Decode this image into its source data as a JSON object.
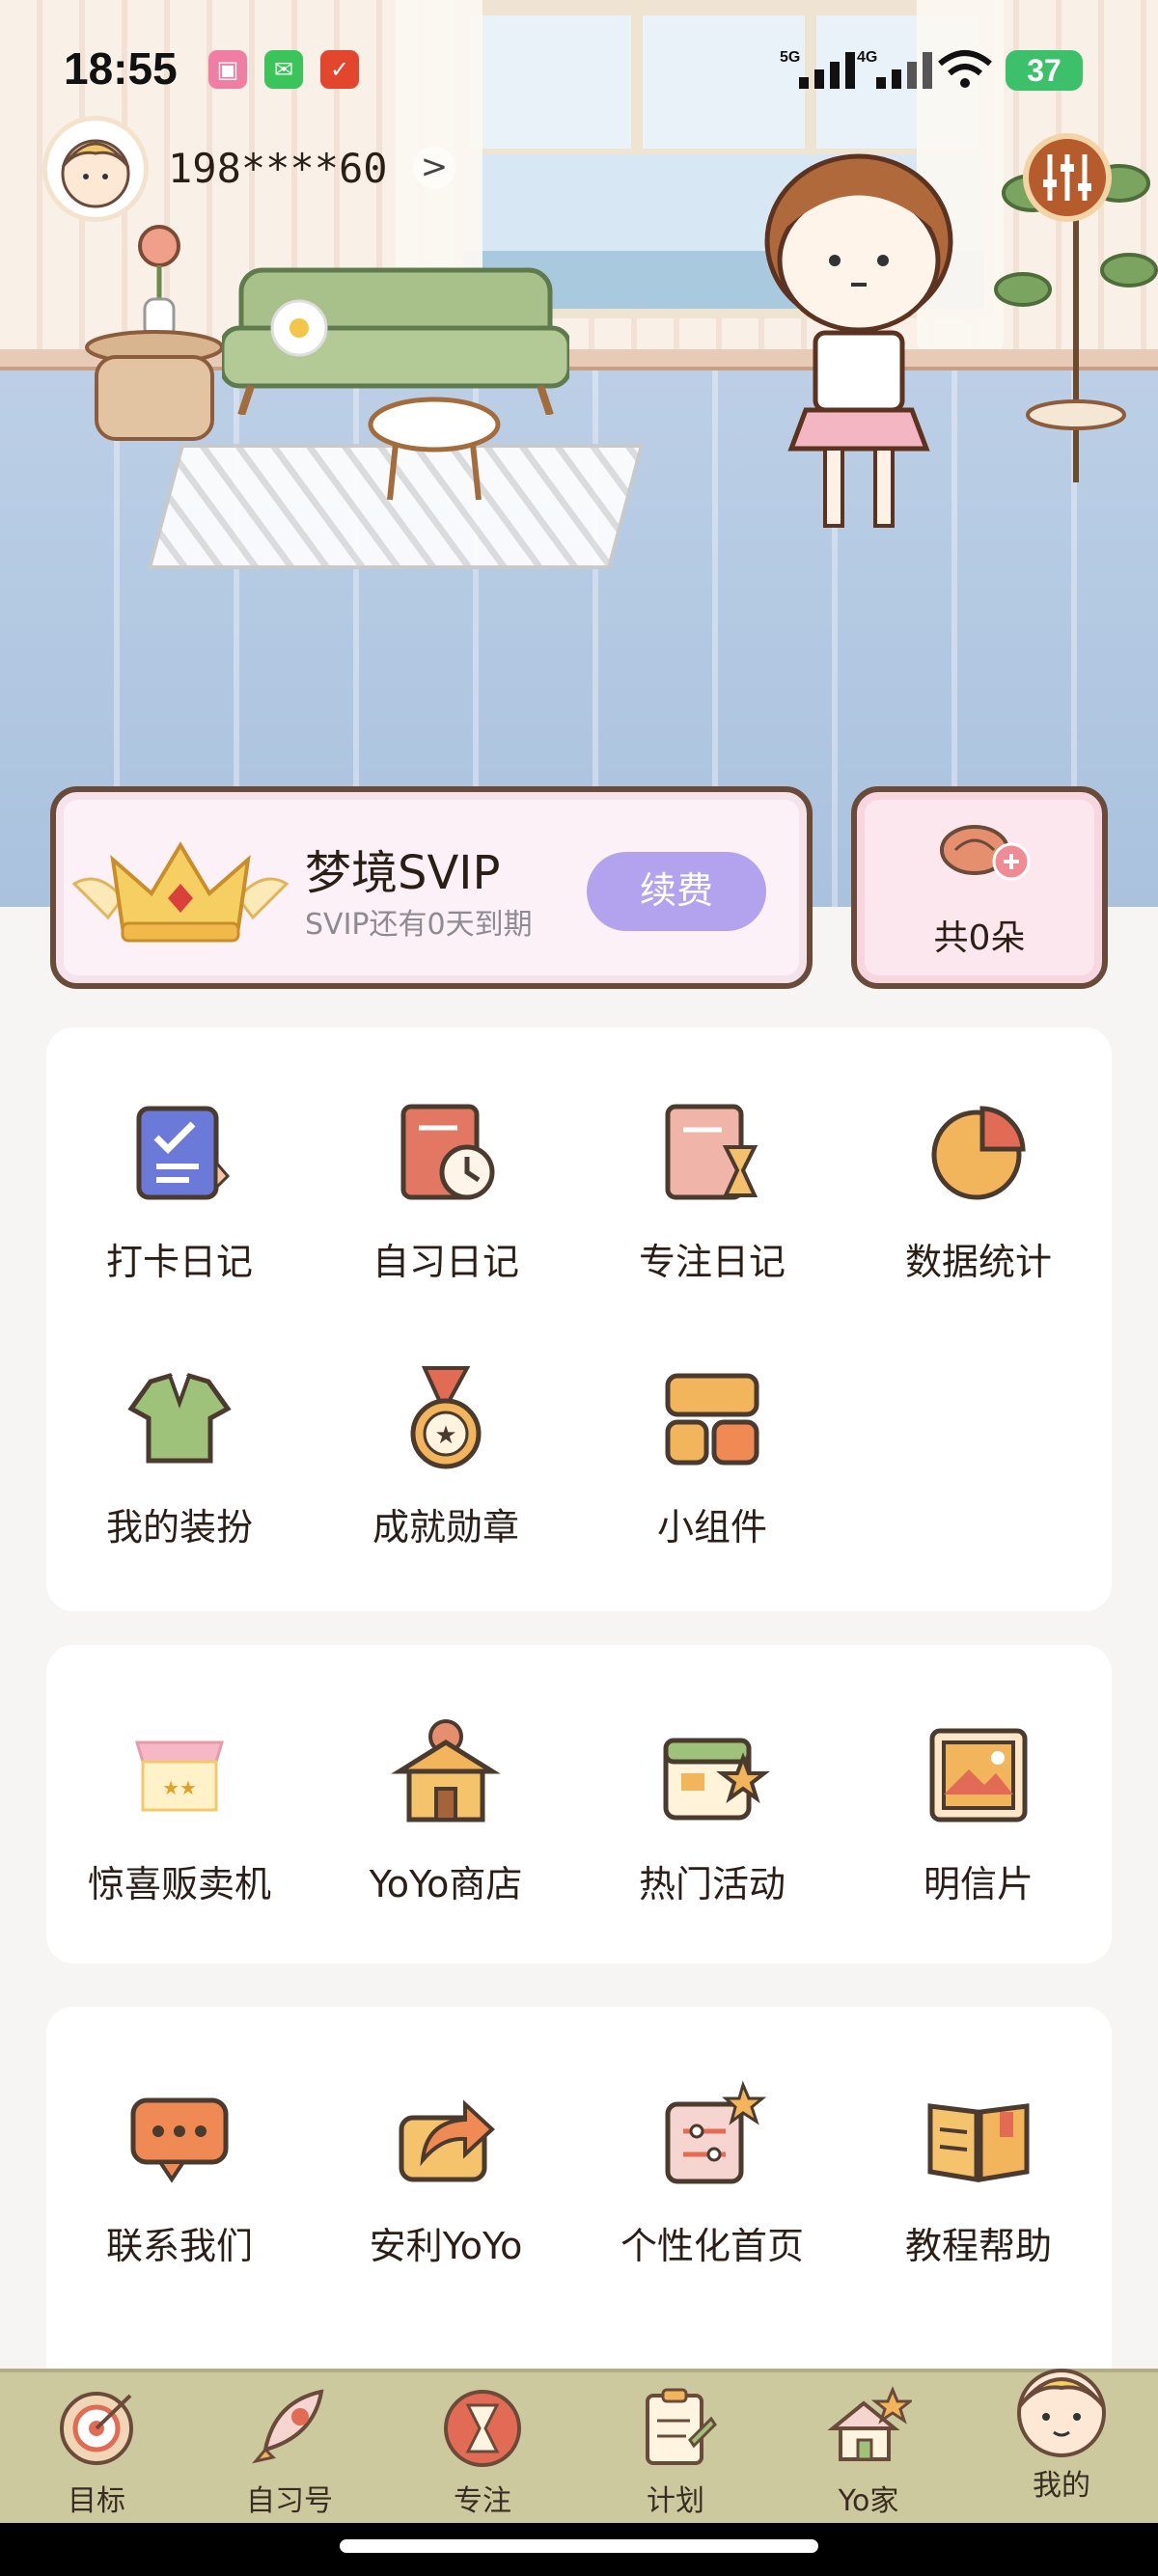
{
  "status_bar": {
    "time": "18:55",
    "network": "5G",
    "network2": "4G",
    "battery": "37"
  },
  "profile": {
    "phone": "198****60",
    "chevron": ">"
  },
  "svip": {
    "title": "梦境SVIP",
    "subtitle": "SVIP还有0天到期",
    "renew_label": "续费"
  },
  "flowers": {
    "count_label": "共0朵"
  },
  "tools_section": {
    "items": [
      {
        "label": "打卡日记",
        "icon": "checklist-notebook-icon"
      },
      {
        "label": "自习日记",
        "icon": "book-clock-icon"
      },
      {
        "label": "专注日记",
        "icon": "hourglass-book-icon"
      },
      {
        "label": "数据统计",
        "icon": "pie-chart-icon"
      },
      {
        "label": "我的装扮",
        "icon": "sweater-icon"
      },
      {
        "label": "成就勋章",
        "icon": "medal-icon"
      },
      {
        "label": "小组件",
        "icon": "widget-icon"
      }
    ]
  },
  "shop_section": {
    "items": [
      {
        "label": "惊喜贩卖机",
        "icon": "vending-machine-icon"
      },
      {
        "label": "YoYo商店",
        "icon": "shop-icon"
      },
      {
        "label": "热门活动",
        "icon": "calendar-star-icon"
      },
      {
        "label": "明信片",
        "icon": "postcard-icon"
      }
    ]
  },
  "help_section": {
    "items": [
      {
        "label": "联系我们",
        "icon": "chat-bubble-icon"
      },
      {
        "label": "安利YoYo",
        "icon": "share-icon"
      },
      {
        "label": "个性化首页",
        "icon": "customize-icon"
      },
      {
        "label": "教程帮助",
        "icon": "open-book-icon"
      }
    ]
  },
  "tab_bar": {
    "tabs": [
      {
        "label": "目标",
        "icon": "target-icon"
      },
      {
        "label": "自习号",
        "icon": "rocket-icon"
      },
      {
        "label": "专注",
        "icon": "hourglass-icon"
      },
      {
        "label": "计划",
        "icon": "clipboard-icon"
      },
      {
        "label": "Yo家",
        "icon": "house-icon"
      },
      {
        "label": "我的",
        "icon": "profile-face-icon"
      }
    ]
  },
  "colors": {
    "accent_purple": "#b3a3ee",
    "tab_bar_bg": "#cdc99e",
    "card_border": "#6a4b3a"
  }
}
